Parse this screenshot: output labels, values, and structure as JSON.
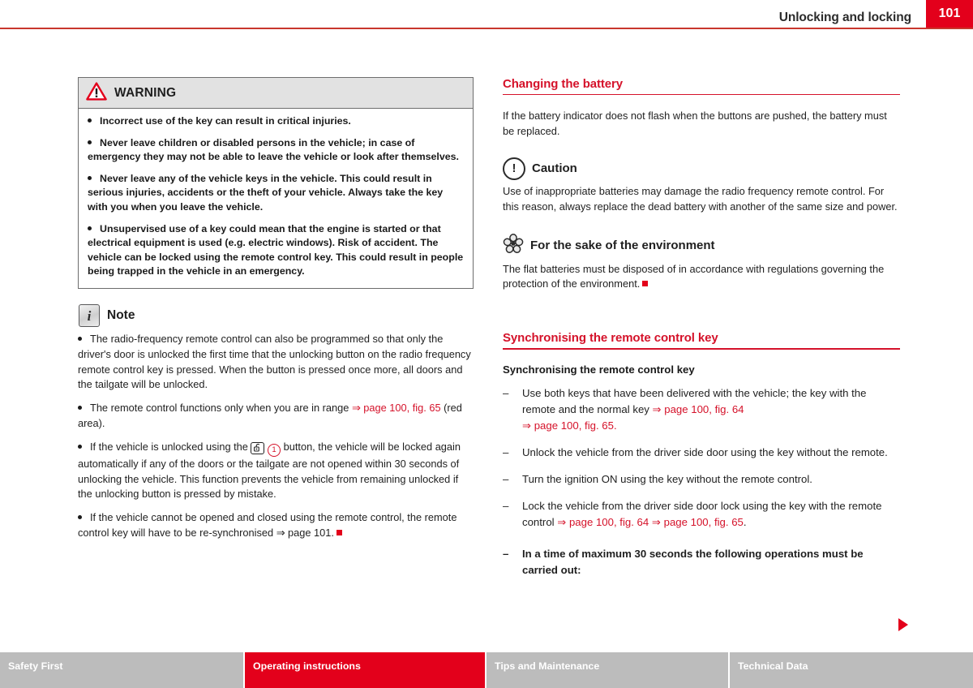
{
  "header": {
    "title": "Unlocking and locking",
    "page_number": "101",
    "rule_color": "#c8372d",
    "accent_color": "#e3001b"
  },
  "left_column": {
    "warning_box": {
      "icon": "warning-triangle-icon",
      "label": "WARNING",
      "items": [
        "Incorrect use of the key can result in critical injuries.",
        "Never leave children or disabled persons in the vehicle; in case of emergency they may not be able to leave the vehicle or look after themselves.",
        "Never leave any of the vehicle keys in the vehicle. This could result in serious injuries, accidents or the theft of your vehicle. Always take the key with you when you leave the vehicle.",
        "Unsupervised use of a key could mean that the engine is started or that electrical equipment is used (e.g. electric windows). Risk of accident. The vehicle can be locked using the remote control key. This could result in people being trapped in the vehicle in an emergency."
      ]
    },
    "note_block": {
      "icon": "info-note-icon",
      "icon_glyph": "i",
      "label": "Note",
      "items": [
        {
          "id": "note-1",
          "text": "The radio-frequency remote control can also be programmed so that only the driver's door is unlocked the first time that the unlocking button on the radio frequency remote control key is pressed. When the button is pressed once more, all doors and the tailgate will be unlocked."
        },
        {
          "id": "note-2",
          "parts": [
            {
              "t": "The remote control functions only when you are in range "
            },
            {
              "t": "⇒ page 100, fig. 65",
              "style": "xref"
            },
            {
              "t": " (red area)."
            }
          ]
        },
        {
          "id": "note-3",
          "parts": [
            {
              "t": "If the vehicle is unlocked using the "
            },
            {
              "t": "unlock-key-icon",
              "style": "icon-keybtn"
            },
            {
              "t": "1",
              "style": "icon-circle-red"
            },
            {
              "t": " button, the vehicle will be locked again automatically if any of the doors or the tailgate are not opened within 30 seconds of unlocking the vehicle. This function prevents the vehicle from remaining unlocked if the unlocking button is pressed by mistake."
            }
          ]
        },
        {
          "id": "note-4",
          "parts": [
            {
              "t": "If the vehicle cannot be opened and closed using the remote control, the remote control key will have to be re-synchronised "
            },
            {
              "t": "⇒ page 101.",
              "style": "normal"
            },
            {
              "t": "end-square",
              "style": "square"
            }
          ]
        }
      ]
    }
  },
  "right_column": {
    "section_battery": {
      "heading": "Changing the battery",
      "intro": "If the battery indicator does not flash when the buttons are pushed, the battery must be replaced.",
      "caution": {
        "icon": "caution-exclamation-icon",
        "icon_glyph": "!",
        "label": "Caution",
        "text": "Use of inappropriate batteries may damage the radio frequency remote control. For this reason, always replace the dead battery with another of the same size and power."
      },
      "environment": {
        "icon": "flower-environment-icon",
        "label": "For the sake of the environment",
        "text": "The flat batteries must be disposed of in accordance with regulations governing the protection of the environment."
      }
    },
    "section_sync": {
      "heading": "Synchronising the remote control key",
      "subtitle": "Synchronising the remote control key",
      "steps": [
        {
          "id": "step-1",
          "bold": false,
          "parts": [
            {
              "t": "Use both keys that have been delivered with the vehicle; the key with the remote and the normal key "
            },
            {
              "t": "⇒ page 100, fig. 64",
              "style": "xref"
            },
            {
              "t": " ",
              "style": "normal"
            },
            {
              "t": "⇒ page 100, fig. 65",
              "style": "xref"
            },
            {
              "t": ".",
              "style": "xref"
            }
          ]
        },
        {
          "id": "step-2",
          "bold": false,
          "parts": [
            {
              "t": "Unlock the vehicle from the driver side door using the key without the remote."
            }
          ]
        },
        {
          "id": "step-3",
          "bold": false,
          "parts": [
            {
              "t": "Turn the ignition ON using the key without the remote control."
            }
          ]
        },
        {
          "id": "step-4",
          "bold": false,
          "parts": [
            {
              "t": "Lock the vehicle from the driver side door lock using the key with the remote control "
            },
            {
              "t": "⇒ page 100, fig. 64",
              "style": "xref"
            },
            {
              "t": " ",
              "style": "normal"
            },
            {
              "t": "⇒ page 100, fig. 65",
              "style": "xref"
            },
            {
              "t": ".",
              "style": "normal"
            }
          ]
        },
        {
          "id": "step-5",
          "bold": true,
          "parts": [
            {
              "t": "In a time of maximum 30 seconds the following operations must be carried out:"
            }
          ]
        }
      ]
    }
  },
  "next_page_arrow": "next-page-arrow-icon",
  "footer": {
    "tabs": [
      {
        "label": "Safety First",
        "active": false
      },
      {
        "label": "Operating instructions",
        "active": true
      },
      {
        "label": "Tips and Maintenance",
        "active": false
      },
      {
        "label": "Technical Data",
        "active": false
      }
    ]
  },
  "dash_mark": "–"
}
